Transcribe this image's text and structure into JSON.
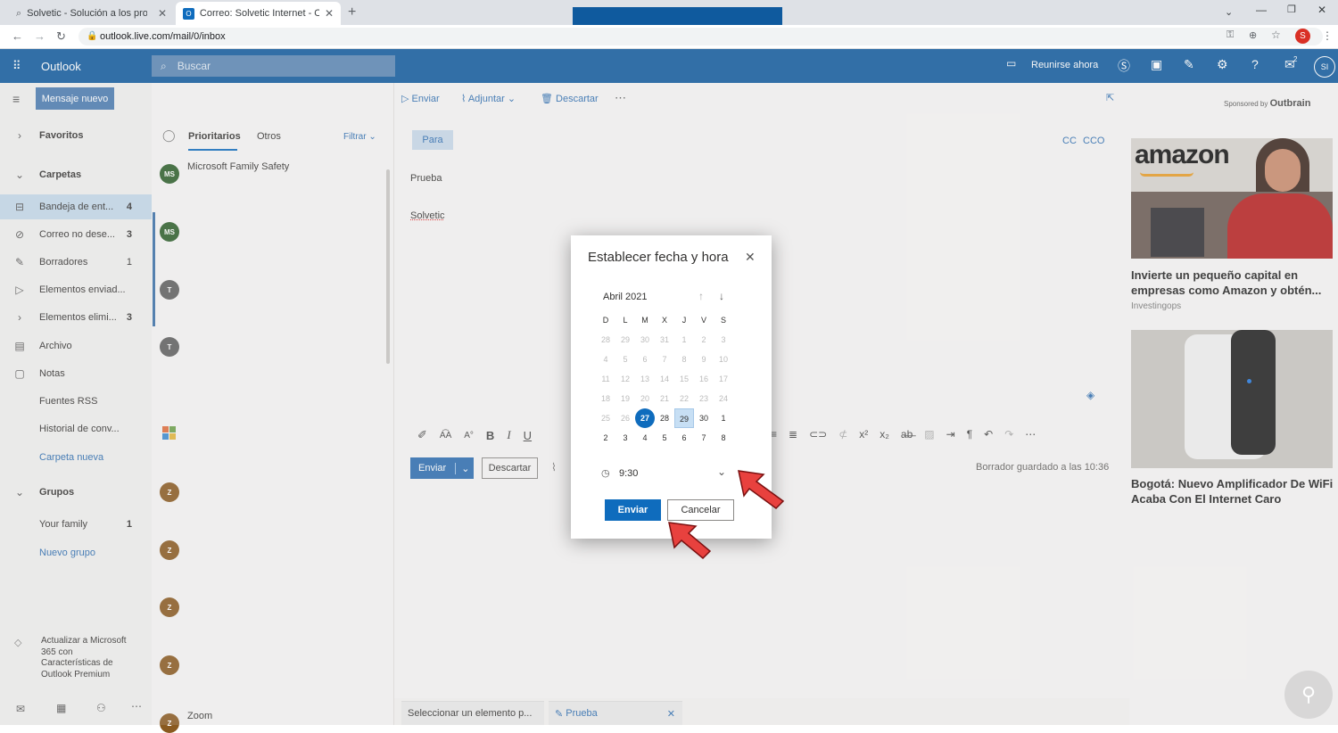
{
  "browser": {
    "tabs": [
      {
        "label": "Solvetic - Solución a los problem",
        "active": false
      },
      {
        "label": "Correo: Solvetic Internet - Outloo",
        "active": true
      }
    ],
    "url": "outlook.live.com/mail/0/inbox",
    "profile_initial": "S"
  },
  "header": {
    "app_name": "Outlook",
    "search_placeholder": "Buscar",
    "meet_now": "Reunirse ahora",
    "notif_count": "2",
    "user_initials": "SI"
  },
  "sidebar": {
    "new_message": "Mensaje nuevo",
    "favorites": "Favoritos",
    "folders": "Carpetas",
    "items": [
      {
        "label": "Bandeja de ent...",
        "count": "4",
        "icon": "inbox-icon"
      },
      {
        "label": "Correo no dese...",
        "count": "3",
        "icon": "blocked-icon"
      },
      {
        "label": "Borradores",
        "count": "1",
        "icon": "pencil-icon"
      },
      {
        "label": "Elementos enviad...",
        "count": "",
        "icon": "send-icon"
      },
      {
        "label": "Elementos elimi...",
        "count": "3",
        "icon": "trash-icon"
      },
      {
        "label": "Archivo",
        "count": "",
        "icon": "archive-icon"
      },
      {
        "label": "Notas",
        "count": "",
        "icon": "notes-icon"
      },
      {
        "label": "Fuentes RSS",
        "count": "",
        "icon": ""
      },
      {
        "label": "Historial de conv...",
        "count": "",
        "icon": ""
      },
      {
        "label": "Carpeta nueva",
        "count": "",
        "icon": ""
      }
    ],
    "groups": "Grupos",
    "group_items": [
      {
        "label": "Your family",
        "count": "1"
      },
      {
        "label": "Nuevo grupo",
        "count": ""
      }
    ],
    "upgrade": "Actualizar a Microsoft 365 con Características de Outlook Premium"
  },
  "msglist": {
    "tab_focused": "Prioritarios",
    "tab_other": "Otros",
    "filter": "Filtrar",
    "first_sender": "Microsoft Family Safety",
    "avatars": [
      "MS",
      "MS",
      "T",
      "T",
      "Z",
      "Z",
      "Z",
      "Z",
      "Z"
    ],
    "last_sender": "Zoom"
  },
  "compose": {
    "send": "Enviar",
    "attach": "Adjuntar",
    "discard": "Descartar",
    "to_label": "Para",
    "cc": "CC",
    "bcc": "CCO",
    "subject": "Prueba",
    "body": "Solvetic",
    "send_btn": "Enviar",
    "discard_btn": "Descartar",
    "draft_saved": "Borrador guardado a las 10:36",
    "bottom_tab1": "Seleccionar un elemento p...",
    "bottom_tab2": "Prueba"
  },
  "modal": {
    "title": "Establecer fecha y hora",
    "month": "Abril 2021",
    "weekdays": [
      "D",
      "L",
      "M",
      "X",
      "J",
      "V",
      "S"
    ],
    "weeks": [
      [
        "28",
        "29",
        "30",
        "31",
        "1",
        "2",
        "3"
      ],
      [
        "4",
        "5",
        "6",
        "7",
        "8",
        "9",
        "10"
      ],
      [
        "11",
        "12",
        "13",
        "14",
        "15",
        "16",
        "17"
      ],
      [
        "18",
        "19",
        "20",
        "21",
        "22",
        "23",
        "24"
      ],
      [
        "25",
        "26",
        "27",
        "28",
        "29",
        "30",
        "1"
      ],
      [
        "2",
        "3",
        "4",
        "5",
        "6",
        "7",
        "8"
      ]
    ],
    "today": "27",
    "selected": "29",
    "time": "9:30",
    "send": "Enviar",
    "cancel": "Cancelar"
  },
  "ads": {
    "sponsored": "Sponsored by",
    "brand": "Outbrain",
    "ad1_logo": "amazon",
    "ad1_title": "Invierte un pequeño capital en empresas como Amazon y obtén...",
    "ad1_source": "Investingops",
    "ad2_title": "Bogotá: Nuevo Amplificador De WiFi Acaba Con El Internet Caro"
  },
  "colors": {
    "brand": "#0f5a9e",
    "accent": "#0f6cbd",
    "arrow": "#e8413e"
  }
}
